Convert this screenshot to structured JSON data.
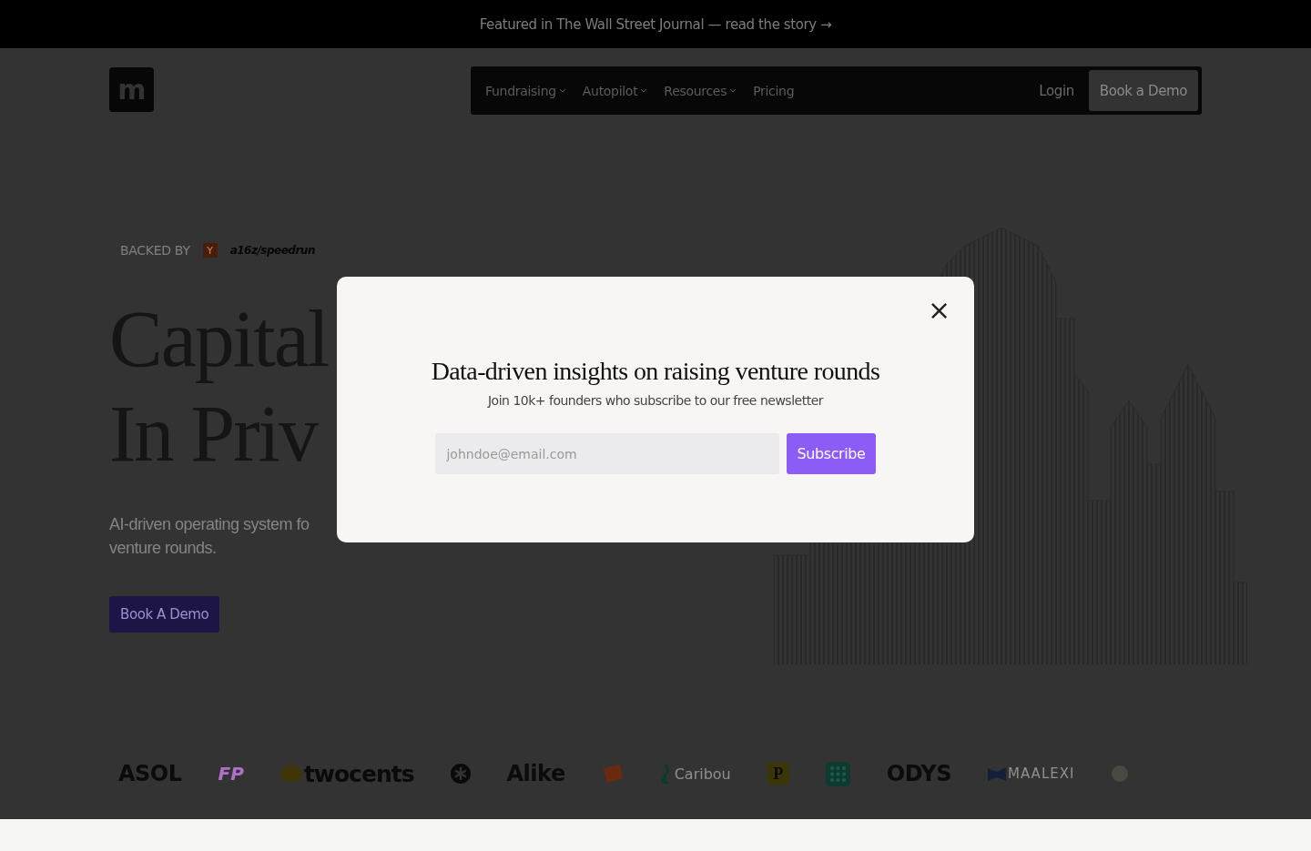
{
  "banner": {
    "text": "Featured in The Wall Street Journal — read the story",
    "arrow": "→"
  },
  "header": {
    "logo": "m",
    "nav_items": [
      {
        "label": "Fundraising",
        "has_menu": true
      },
      {
        "label": "Autopilot",
        "has_menu": true
      },
      {
        "label": "Resources",
        "has_menu": true
      },
      {
        "label": "Pricing",
        "has_menu": false
      }
    ],
    "login": "Login",
    "cta": "Book a Demo"
  },
  "hero": {
    "backed_by": "BACKED BY",
    "backers": [
      {
        "kind": "square",
        "label": "Y"
      },
      {
        "kind": "wordmark",
        "label": "a16z/speedrun"
      }
    ],
    "headline_lines": [
      "Capital",
      "In Priv"
    ],
    "subtitle_lines": [
      "AI-driven operating system fo",
      "venture rounds."
    ],
    "cta": "Book A Demo"
  },
  "logos": [
    {
      "kind": "text",
      "label": "ASOL"
    },
    {
      "kind": "text-color",
      "label": "FP"
    },
    {
      "kind": "coin-text",
      "label": "twocents"
    },
    {
      "kind": "star"
    },
    {
      "kind": "text",
      "label": "Alike"
    },
    {
      "kind": "orange"
    },
    {
      "kind": "leaf-text",
      "label": "Caribou"
    },
    {
      "kind": "p-square",
      "label": "P"
    },
    {
      "kind": "grid"
    },
    {
      "kind": "text",
      "label": "ODYS"
    },
    {
      "kind": "flag-text",
      "label": "MAALEXI"
    },
    {
      "kind": "faint"
    }
  ],
  "modal": {
    "title": "Data-driven insights on raising venture rounds",
    "subtitle": "Join 10k+ founders who subscribe to our free newsletter",
    "email": {
      "placeholder": "johndoe@email.com"
    },
    "button": "Subscribe",
    "close": "×"
  }
}
